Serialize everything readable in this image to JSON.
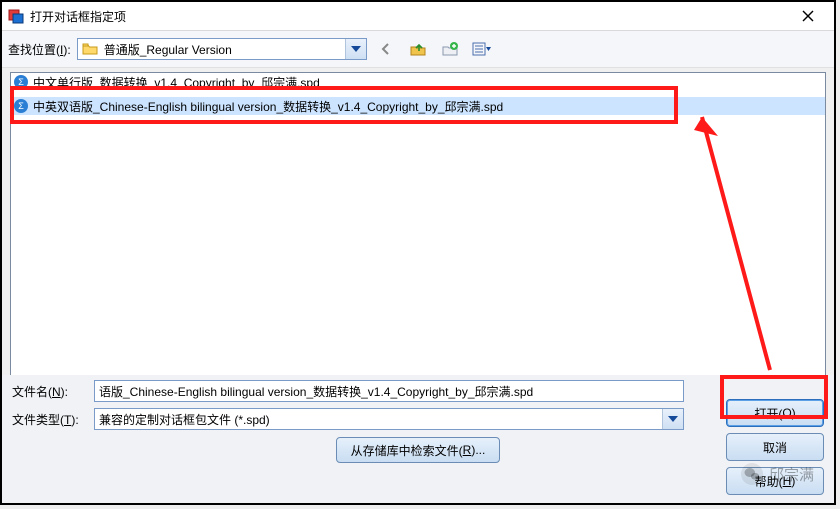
{
  "title": "打开对话框指定项",
  "lookin_label_pre": "查找位置(",
  "lookin_label_u": "I",
  "lookin_label_post": "):",
  "lookin_value": "普通版_Regular Version",
  "files": [
    "中文单行版_数据转换_v1.4_Copyright_by_邱宗满.spd",
    "中英双语版_Chinese-English bilingual version_数据转换_v1.4_Copyright_by_邱宗满.spd"
  ],
  "filename_label_pre": "文件名(",
  "filename_label_u": "N",
  "filename_label_post": "):",
  "filename_value": "语版_Chinese-English bilingual version_数据转换_v1.4_Copyright_by_邱宗满.spd",
  "filetype_label_pre": "文件类型(",
  "filetype_label_u": "T",
  "filetype_label_post": "):",
  "filetype_value": "兼容的定制对话框包文件 (*.spd)",
  "open_btn_pre": "打开(",
  "open_btn_u": "O",
  "open_btn_post": ")",
  "cancel_btn": "取消",
  "help_btn_pre": "帮助(",
  "help_btn_u": "H",
  "help_btn_post": ")",
  "repo_btn_pre": "从存储库中检索文件(",
  "repo_btn_u": "R",
  "repo_btn_post": ")...",
  "watermark": "邱宗满"
}
